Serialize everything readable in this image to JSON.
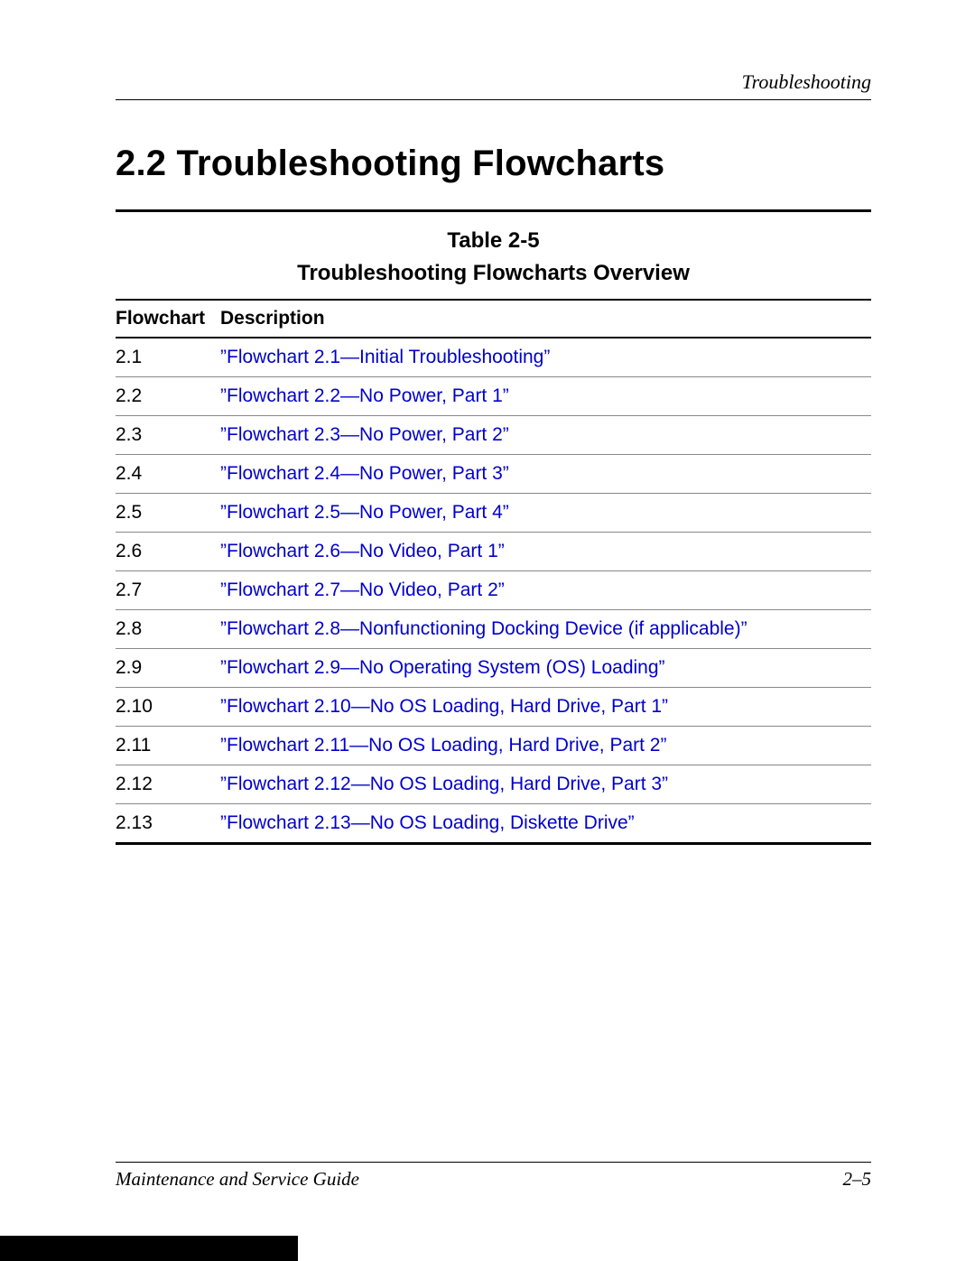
{
  "header": {
    "running_head": "Troubleshooting"
  },
  "section": {
    "number": "2.2",
    "title": "Troubleshooting Flowcharts"
  },
  "table": {
    "label": "Table 2-5",
    "title": "Troubleshooting Flowcharts Overview",
    "columns": {
      "flowchart": "Flowchart",
      "description": "Description"
    },
    "rows": [
      {
        "num": "2.1",
        "desc": "”Flowchart 2.1—Initial Troubleshooting”"
      },
      {
        "num": "2.2",
        "desc": "”Flowchart 2.2—No Power, Part 1”"
      },
      {
        "num": "2.3",
        "desc": "”Flowchart 2.3—No Power, Part 2”"
      },
      {
        "num": "2.4",
        "desc": "”Flowchart 2.4—No Power, Part 3”"
      },
      {
        "num": "2.5",
        "desc": "”Flowchart 2.5—No Power, Part 4”"
      },
      {
        "num": "2.6",
        "desc": "”Flowchart 2.6—No Video, Part 1”"
      },
      {
        "num": "2.7",
        "desc": "”Flowchart 2.7—No Video, Part 2”"
      },
      {
        "num": "2.8",
        "desc": "”Flowchart 2.8—Nonfunctioning Docking Device (if applicable)”"
      },
      {
        "num": "2.9",
        "desc": "”Flowchart 2.9—No Operating System (OS) Loading”"
      },
      {
        "num": "2.10",
        "desc": "”Flowchart 2.10—No OS Loading, Hard Drive, Part 1”"
      },
      {
        "num": "2.11",
        "desc": "”Flowchart 2.11—No OS Loading, Hard Drive, Part 2”"
      },
      {
        "num": "2.12",
        "desc": "”Flowchart 2.12—No OS Loading, Hard Drive, Part 3”"
      },
      {
        "num": "2.13",
        "desc": "”Flowchart 2.13—No OS Loading, Diskette Drive”"
      }
    ]
  },
  "footer": {
    "left": "Maintenance and Service Guide",
    "right": "2–5"
  }
}
